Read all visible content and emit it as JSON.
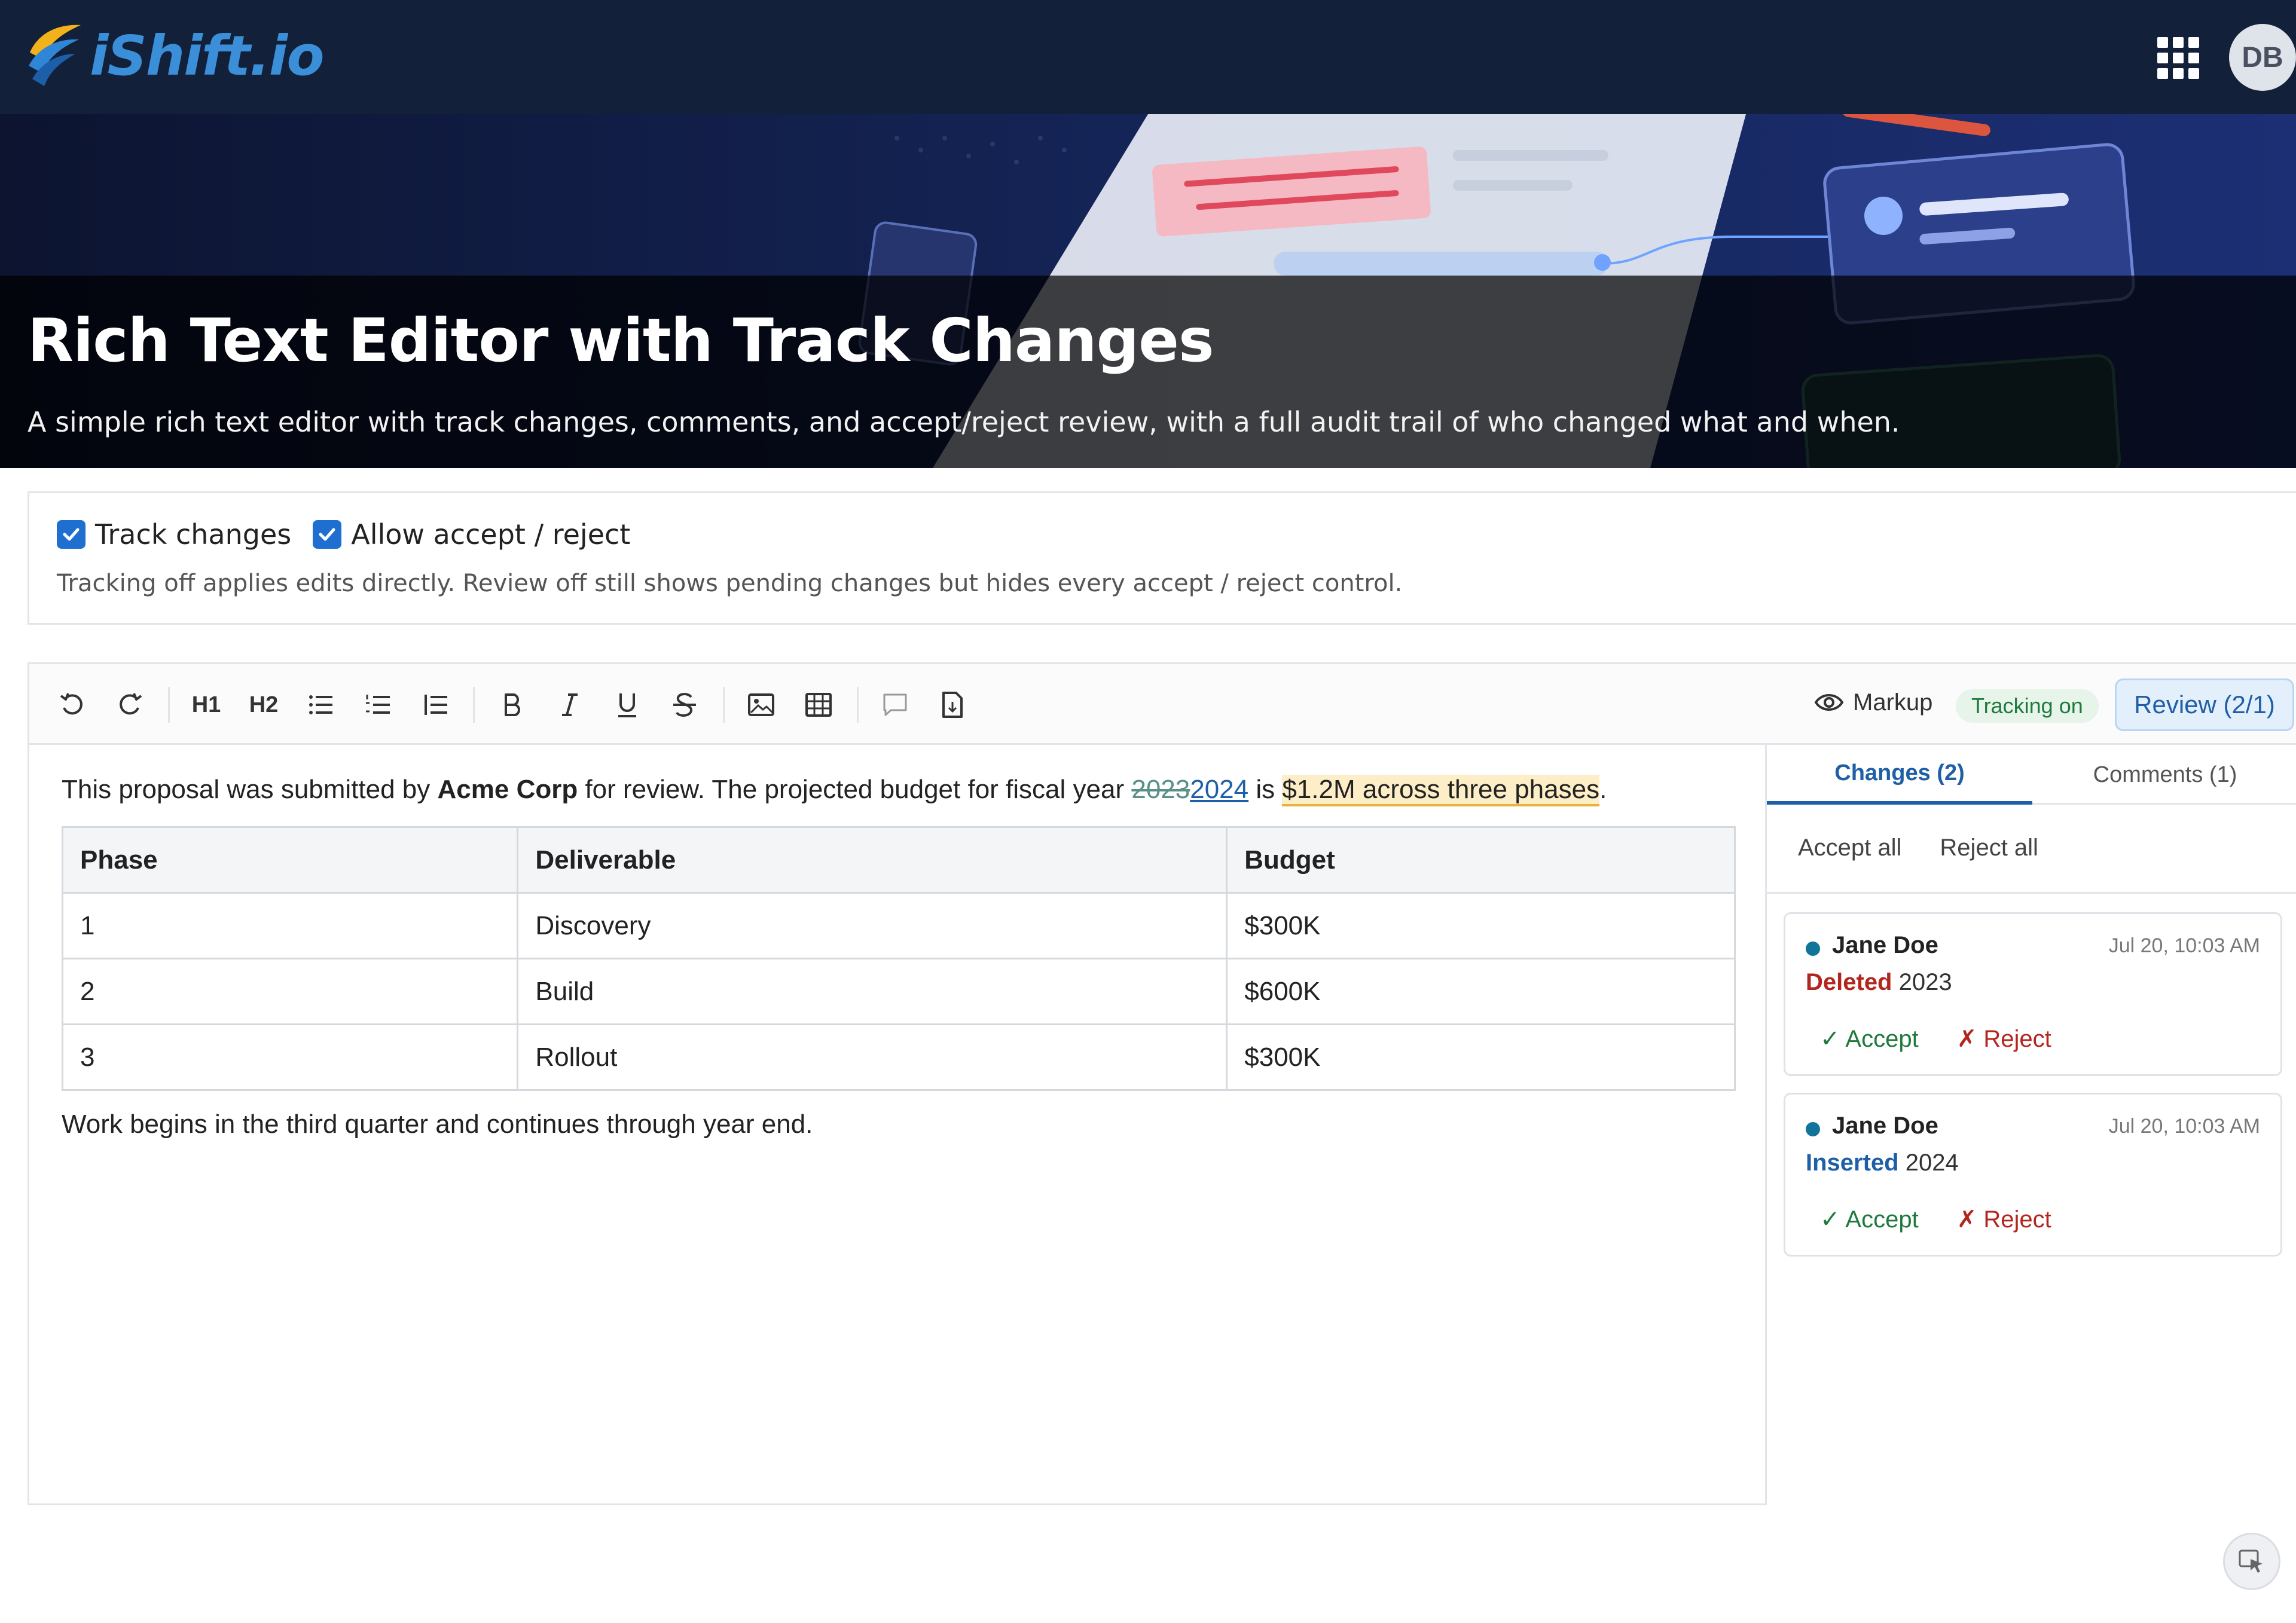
{
  "brand": {
    "name": "iShift.io"
  },
  "header": {
    "avatar_initials": "DB"
  },
  "hero": {
    "title": "Rich Text Editor with Track Changes",
    "subtitle": "A simple rich text editor with track changes, comments, and accept/reject review, with a full audit trail of who changed what and when."
  },
  "options": {
    "track_changes": {
      "label": "Track changes",
      "checked": true
    },
    "allow_review": {
      "label": "Allow accept / reject",
      "checked": true
    },
    "help": "Tracking off applies edits directly. Review off still shows pending changes but hides every accept / reject control."
  },
  "toolbar": {
    "h1": "H1",
    "h2": "H2",
    "markup_label": "Markup",
    "tracking_status": "Tracking on",
    "review_label": "Review (2/1)"
  },
  "document": {
    "p1": {
      "before": "This proposal was submitted by ",
      "bold": "Acme Corp",
      "middle": " for review. The projected budget for fiscal year ",
      "deleted": "2023",
      "inserted": "2024",
      "after": " is ",
      "highlighted": "$1.2M across three phases",
      "end": "."
    },
    "table": {
      "headers": [
        "Phase",
        "Deliverable",
        "Budget"
      ],
      "rows": [
        [
          "1",
          "Discovery",
          "$300K"
        ],
        [
          "2",
          "Build",
          "$600K"
        ],
        [
          "3",
          "Rollout",
          "$300K"
        ]
      ]
    },
    "p2": "Work begins in the third quarter and continues through year end."
  },
  "panel": {
    "tabs": {
      "changes": "Changes (2)",
      "comments": "Comments (1)"
    },
    "accept_all": "Accept all",
    "reject_all": "Reject all",
    "changes": [
      {
        "author": "Jane Doe",
        "time": "Jul 20, 10:03 AM",
        "kind": "Deleted",
        "text": "2023",
        "accept": "✓ Accept",
        "reject": "✗ Reject"
      },
      {
        "author": "Jane Doe",
        "time": "Jul 20, 10:03 AM",
        "kind": "Inserted",
        "text": "2024",
        "accept": "✓ Accept",
        "reject": "✗ Reject"
      }
    ]
  },
  "colors": {
    "topbar": "#13203a",
    "accent": "#1e5fa8",
    "accept": "#1e7a3c",
    "reject": "#b3261e"
  }
}
